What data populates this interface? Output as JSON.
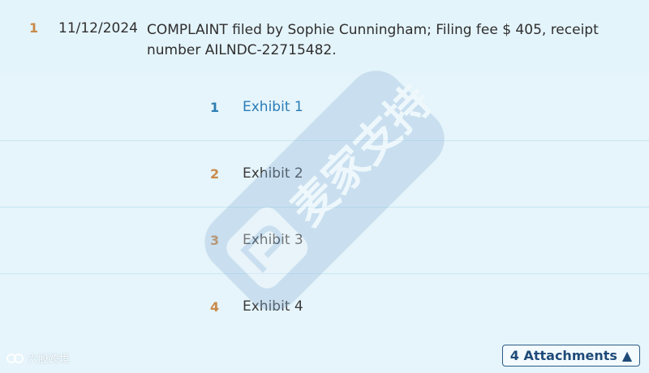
{
  "entry": {
    "number": "1",
    "date": "11/12/2024",
    "text": "COMPLAINT filed by Sophie Cunningham; Filing fee $ 405, receipt number AILNDC-22715482."
  },
  "attachments": [
    {
      "number": "1",
      "label": "Exhibit 1"
    },
    {
      "number": "2",
      "label": "Exhibit 2"
    },
    {
      "number": "3",
      "label": "Exhibit 3"
    },
    {
      "number": "4",
      "label": "Exhibit 4"
    }
  ],
  "toggle": {
    "label": "4 Attachments",
    "icon": "▲"
  },
  "watermark": {
    "text": "麦家支持"
  },
  "brand": {
    "text": "六股跨境"
  },
  "colors": {
    "accent": "#2a7cb8",
    "number": "#c98a4a",
    "background": "#e6f5fb"
  }
}
